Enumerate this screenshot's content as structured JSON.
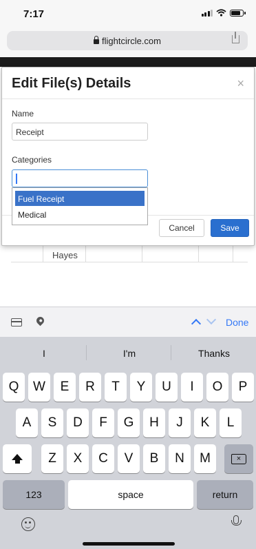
{
  "status_bar": {
    "time": "7:17"
  },
  "browser": {
    "url": "flightcircle.com"
  },
  "background_page": {
    "table_cell": "Hayes"
  },
  "modal": {
    "title": "Edit File(s) Details",
    "close_label": "×",
    "name_label": "Name",
    "name_value": "Receipt",
    "categories_label": "Categories",
    "categories_value": "",
    "dropdown_options": [
      "Fuel Receipt",
      "Medical"
    ],
    "selected_option": "Fuel Receipt",
    "cancel_label": "Cancel",
    "save_label": "Save"
  },
  "keyboard_toolbar": {
    "done_label": "Done"
  },
  "keyboard": {
    "suggestions": [
      "I",
      "I'm",
      "Thanks"
    ],
    "row1": [
      "Q",
      "W",
      "E",
      "R",
      "T",
      "Y",
      "U",
      "I",
      "O",
      "P"
    ],
    "row2": [
      "A",
      "S",
      "D",
      "F",
      "G",
      "H",
      "J",
      "K",
      "L"
    ],
    "row3": [
      "Z",
      "X",
      "C",
      "V",
      "B",
      "N",
      "M"
    ],
    "numbers_label": "123",
    "space_label": "space",
    "return_label": "return"
  },
  "colors": {
    "accent": "#3478f6",
    "save_button": "#2a6fcf",
    "selected_option": "#3a72c8"
  }
}
